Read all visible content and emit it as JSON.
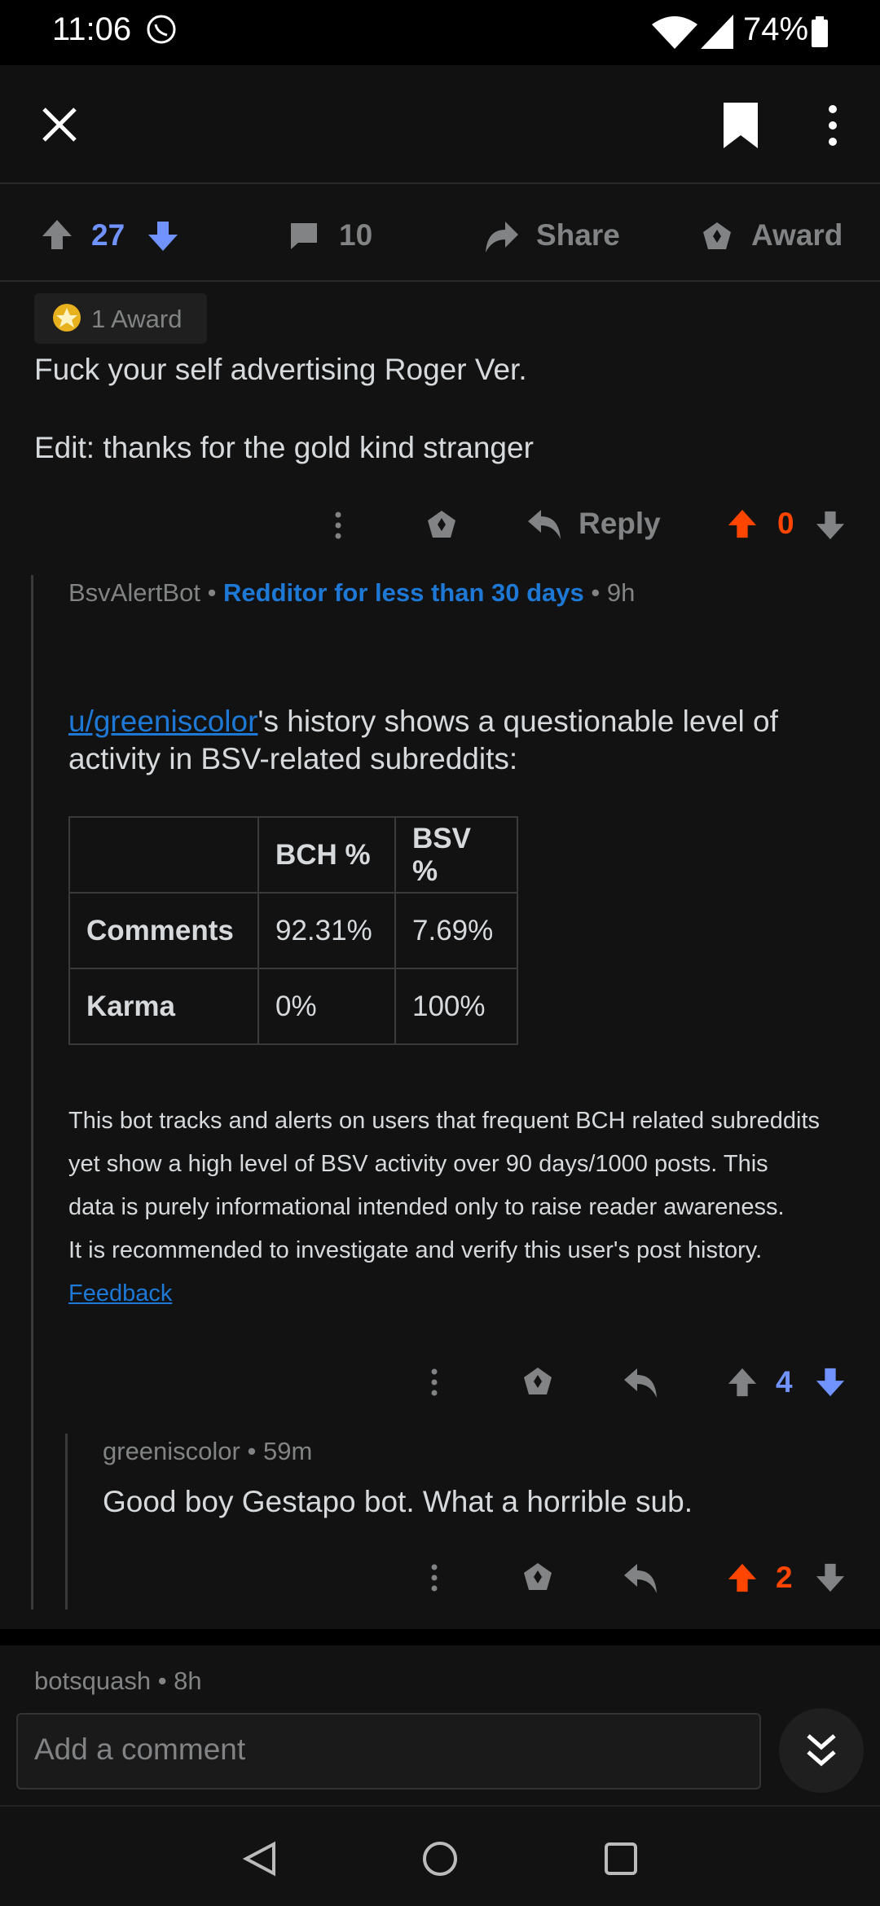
{
  "status_bar": {
    "time": "11:06",
    "battery": "74%"
  },
  "action_bar": {
    "score": "27",
    "comments": "10",
    "share": "Share",
    "award": "Award"
  },
  "post_comment": {
    "award_badge": "1 Award",
    "body_line1": "Fuck your self advertising Roger Ver.",
    "body_line2": "Edit: thanks for the gold kind stranger",
    "reply_label": "Reply",
    "score": "0"
  },
  "bot_comment": {
    "author": "BsvAlertBot",
    "flair": "Redditor for less than 30 days",
    "age": "9h",
    "user_link": "u/greeniscolor",
    "intro_rest": "'s history shows a questionable level of",
    "intro_line2": "activity in BSV-related subreddits:",
    "table": {
      "headers": [
        "",
        "BCH %",
        "BSV %"
      ],
      "rows": [
        [
          "Comments",
          "92.31%",
          "7.69%"
        ],
        [
          "Karma",
          "0%",
          "100%"
        ]
      ]
    },
    "note_lines": [
      "This bot tracks and alerts on users that frequent BCH related subreddits",
      "yet show a high level of BSV activity over 90 days/1000 posts. This",
      "data is purely informational intended only to raise reader awareness.",
      "It is recommended to investigate and verify this user's post history."
    ],
    "feedback": "Feedback",
    "score": "4"
  },
  "reply_comment": {
    "author": "greeniscolor",
    "age": "59m",
    "body": "Good boy Gestapo bot. What a horrible sub.",
    "score": "2"
  },
  "next_comment": {
    "author": "botsquash",
    "age": "8h"
  },
  "comment_input": {
    "placeholder": "Add a comment"
  },
  "colors": {
    "upvote": "#ff4500",
    "downvote": "#7193ff",
    "link": "#1e78d6",
    "background": "#121212"
  }
}
